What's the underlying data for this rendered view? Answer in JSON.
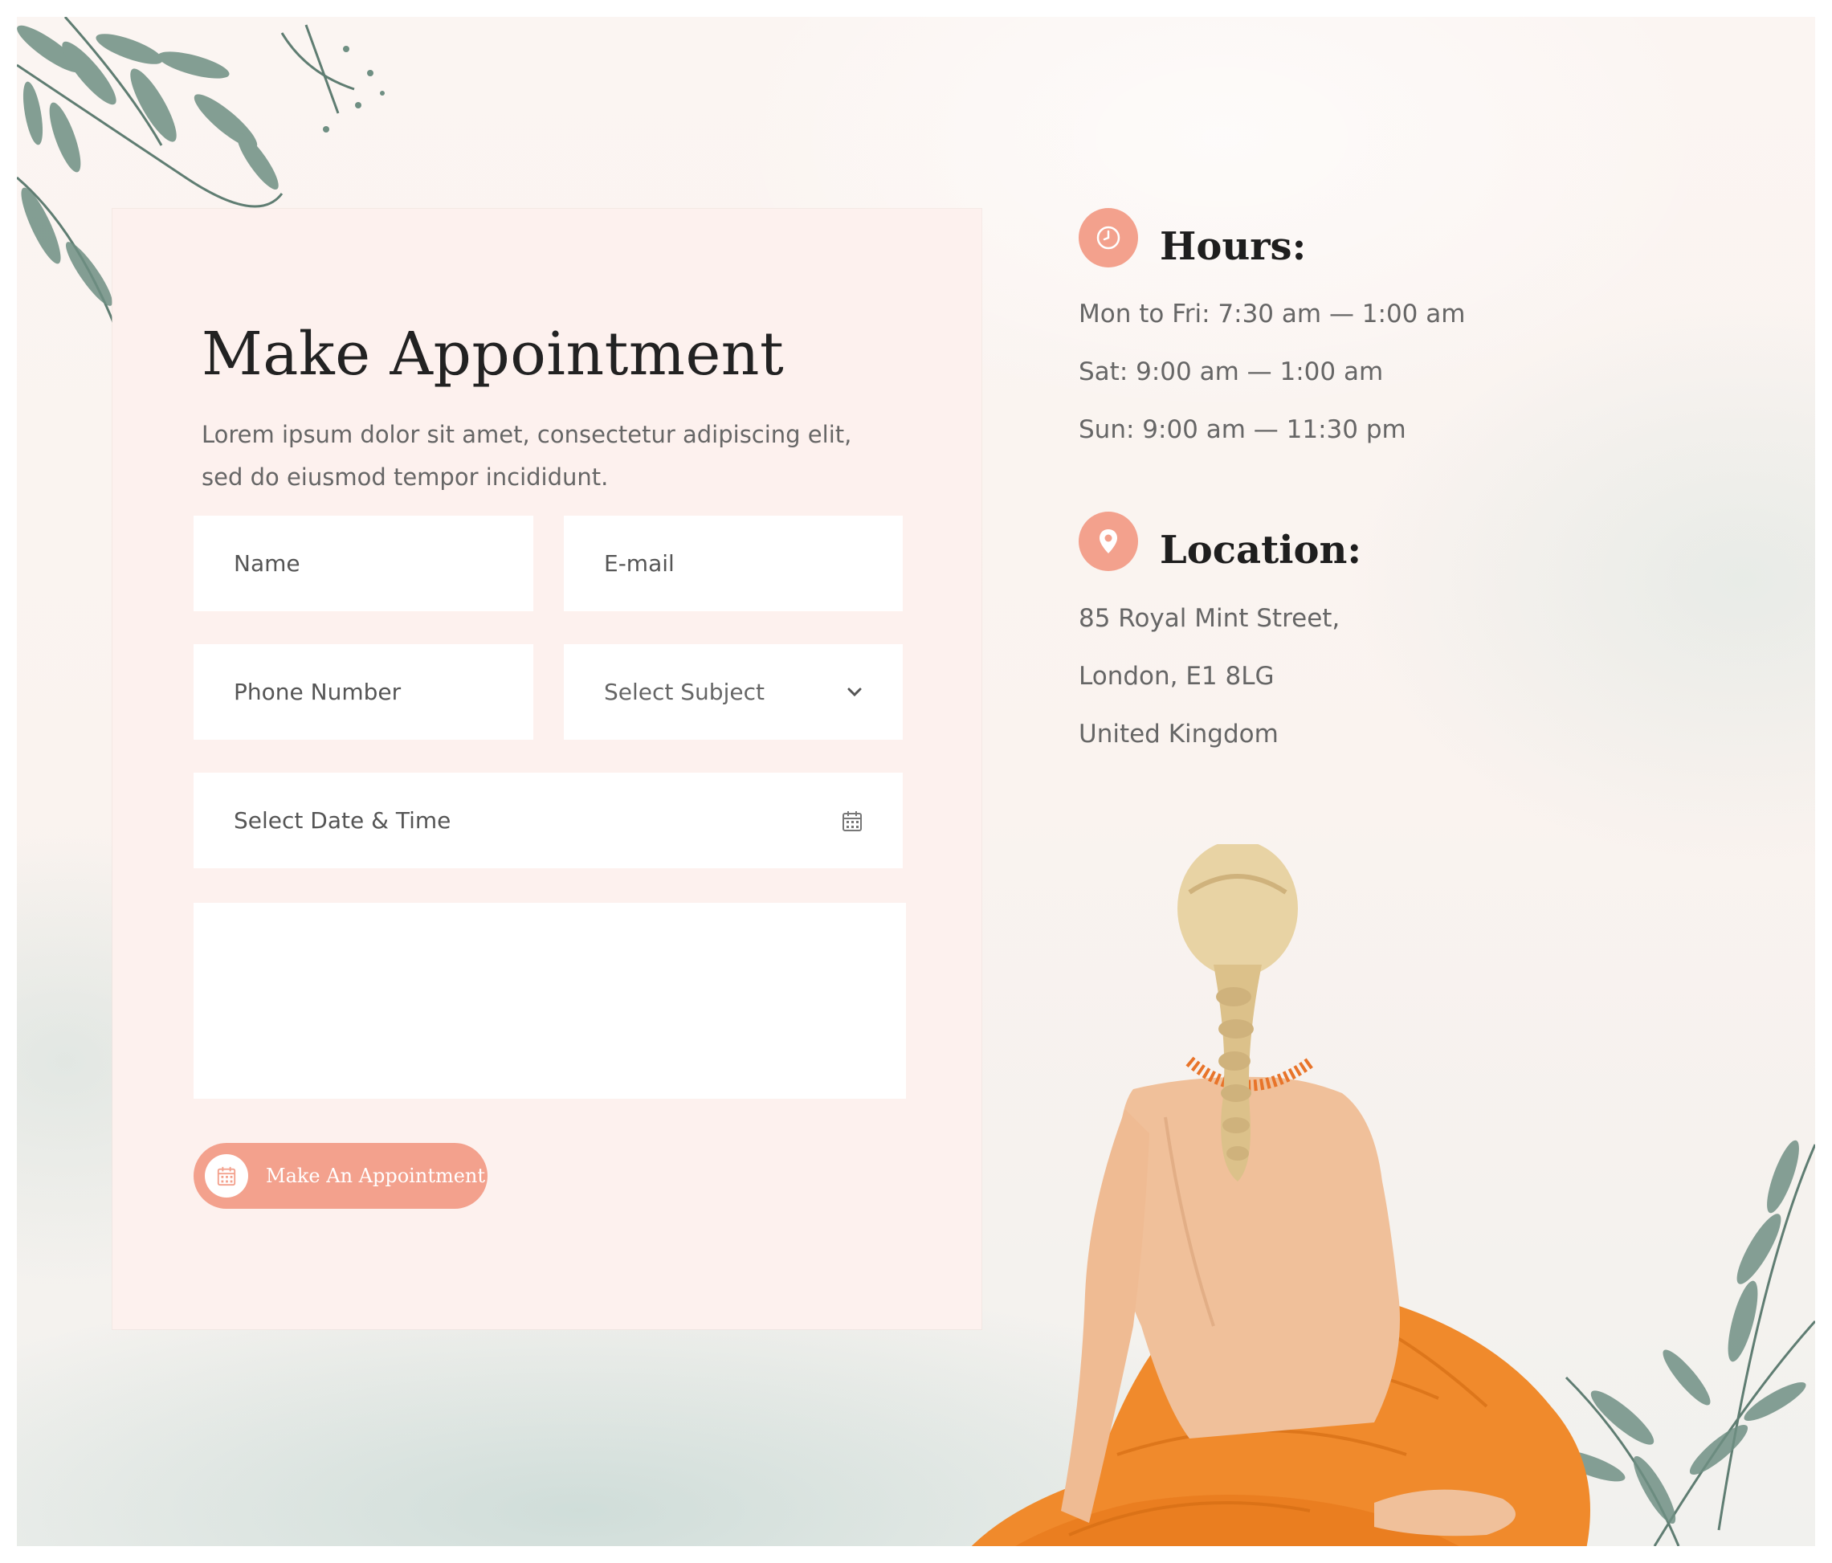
{
  "form": {
    "title": "Make Appointment",
    "intro": "Lorem ipsum dolor sit amet, consectetur adipiscing elit, sed do eiusmod tempor incididunt.",
    "fields": {
      "name_placeholder": "Name",
      "email_placeholder": "E-mail",
      "phone_placeholder": "Phone Number",
      "subject_selected": "Select Subject",
      "datetime_placeholder": "Select Date & Time",
      "message_placeholder": ""
    },
    "submit": {
      "label": "Make An Appointment",
      "icon": "calendar-icon"
    }
  },
  "hours": {
    "heading": "Hours:",
    "icon": "clock-icon",
    "lines": [
      "Mon to Fri: 7:30 am — 1:00 am",
      "Sat: 9:00 am — 1:00 am",
      "Sun: 9:00 am — 11:30 pm"
    ]
  },
  "location": {
    "heading": "Location:",
    "icon": "map-pin-icon",
    "lines": [
      "85 Royal Mint Street,",
      "London, E1 8LG",
      "United Kingdom"
    ]
  },
  "colors": {
    "accent": "#f3a18d",
    "card_background": "#fdf1ee",
    "heading_text": "#222222",
    "body_text": "#666666"
  }
}
